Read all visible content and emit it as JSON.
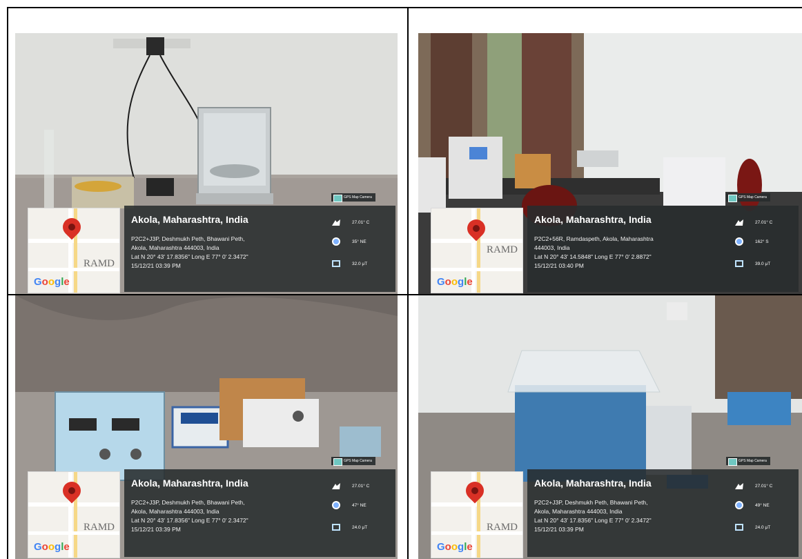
{
  "cells": [
    {
      "badge": "GPS Map Camera",
      "title": "Akola, Maharashtra, India",
      "address_1": "P2C2+J3P, Deshmukh Peth, Bhawani Peth,",
      "address_2": "Akola, Maharashtra 444003, India",
      "latlong": "Lat N 20° 43' 17.8356\" Long E 77° 0' 2.3472\"",
      "datetime": "15/12/21 03:39 PM",
      "temp": "27.01° C",
      "wind": "35° NE",
      "magnetic": "32.0 μT",
      "map_label": "RAMD",
      "map_logo": "Google"
    },
    {
      "badge": "GPS Map Camera",
      "title": "Akola, Maharashtra, India",
      "address_1": "P2C2+56R, Ramdaspeth, Akola, Maharashtra",
      "address_2": "444003, India",
      "latlong": "Lat N 20° 43' 14.5848\" Long E 77° 0' 2.8872\"",
      "datetime": "15/12/21 03:40 PM",
      "temp": "27.01° C",
      "wind": "162° S",
      "magnetic": "39.0 μT",
      "map_label": "RAMD",
      "map_logo": "Google"
    },
    {
      "badge": "GPS Map Camera",
      "title": "Akola, Maharashtra, India",
      "address_1": "P2C2+J3P, Deshmukh Peth, Bhawani Peth,",
      "address_2": "Akola, Maharashtra 444003, India",
      "latlong": "Lat N 20° 43' 17.8356\" Long E 77° 0' 2.3472\"",
      "datetime": "15/12/21 03:39 PM",
      "temp": "27.01° C",
      "wind": "47° NE",
      "magnetic": "24.0 μT",
      "map_label": "RAMD",
      "map_logo": "Google"
    },
    {
      "badge": "GPS Map Camera",
      "title": "Akola, Maharashtra, India",
      "address_1": "P2C2+J3P, Deshmukh Peth, Bhawani Peth,",
      "address_2": "Akola, Maharashtra 444003, India",
      "latlong": "Lat N 20° 43' 17.8356\" Long E 77° 0' 2.3472\"",
      "datetime": "15/12/21 03:39 PM",
      "temp": "27.01° C",
      "wind": "49° NE",
      "magnetic": "24.0 μT",
      "map_label": "RAMD",
      "map_logo": "Google"
    }
  ]
}
